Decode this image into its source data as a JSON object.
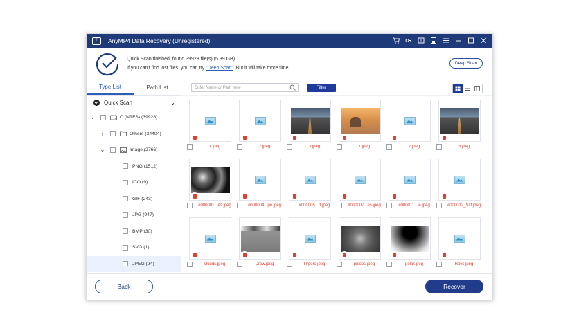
{
  "window": {
    "title": "AnyMP4 Data Recovery (Unregistered)",
    "controls": [
      "cart-icon",
      "key-icon",
      "register-icon",
      "save-icon",
      "menu-icon",
      "minimize-icon",
      "maximize-icon",
      "close-icon"
    ]
  },
  "scan": {
    "status": "Quick Scan finished, found 39928 file(s) (5.39 GB)",
    "hint_prefix": "If you can't find lost files, you can try ",
    "hint_link": "\"Deep Scan\"",
    "hint_suffix": ". But it will take more time.",
    "deep_scan_label": "Deep Scan"
  },
  "sidebar": {
    "tabs": [
      {
        "label": "Type List",
        "active": true
      },
      {
        "label": "Path List",
        "active": false
      }
    ],
    "mode": "Quick Scan",
    "tree": [
      {
        "label": "C:(NTFS) (39928)"
      },
      {
        "label": "Others (34404)"
      },
      {
        "label": "Image (2766)"
      },
      {
        "label": "PNG (1512)"
      },
      {
        "label": "ICO (9)"
      },
      {
        "label": "GIF (243)"
      },
      {
        "label": "JPG (947)"
      },
      {
        "label": "BMP (30)"
      },
      {
        "label": "SVG (1)"
      },
      {
        "label": "JPEG (24)"
      }
    ]
  },
  "toolbar": {
    "search_placeholder": "Enter Name or Path here",
    "filter_label": "Filter"
  },
  "files": [
    {
      "name": "1.jpeg",
      "thumb": "placeholder"
    },
    {
      "name": "2.jpeg",
      "thumb": "placeholder"
    },
    {
      "name": "3.jpeg",
      "thumb": "road"
    },
    {
      "name": "1.jpeg",
      "thumb": "kid"
    },
    {
      "name": "2.jpeg",
      "thumb": "placeholder"
    },
    {
      "name": "3.jpeg",
      "thumb": "road"
    },
    {
      "name": "#000001...es.jpeg",
      "thumb": "clouds"
    },
    {
      "name": "#000004...pe.jpeg",
      "thumb": "placeholder"
    },
    {
      "name": "#000005...rt.jpeg",
      "thumb": "placeholder"
    },
    {
      "name": "#000007...es.jpeg",
      "thumb": "placeholder"
    },
    {
      "name": "#000011...le.jpeg",
      "thumb": "placeholder"
    },
    {
      "name": "#000012_Sift.jpeg",
      "thumb": "placeholder"
    },
    {
      "name": "clouds.jpeg",
      "thumb": "placeholder"
    },
    {
      "name": "Drew.jpeg",
      "thumb": "drew"
    },
    {
      "name": "fingers.jpeg",
      "thumb": "placeholder"
    },
    {
      "name": "pieces.jpeg",
      "thumb": "pieces"
    },
    {
      "name": "polar.jpeg",
      "thumb": "polar"
    },
    {
      "name": "Rays.jpeg",
      "thumb": "placeholder"
    }
  ],
  "footer": {
    "back_label": "Back",
    "recover_label": "Recover"
  },
  "colors": {
    "titlebar": "#1e3a78",
    "accent": "#2d5fb8",
    "button": "#223c8c",
    "filename": "#e0412f"
  }
}
